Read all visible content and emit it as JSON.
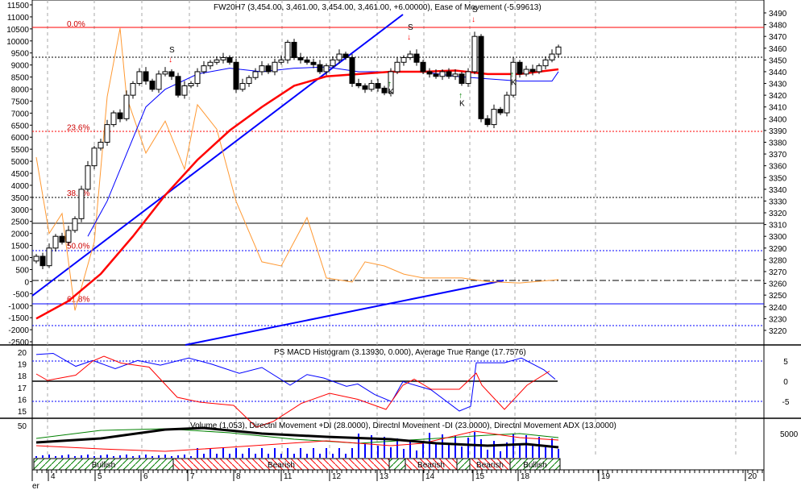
{
  "chart_data": [
    {
      "type": "candlestick",
      "title": "FW20H7 (3,454.00, 3,461.00, 3,454.00, 3,461.00, +6.00000), Ease of Movement (-5.99613)",
      "left_axis": {
        "range": [
          -2500,
          11500
        ],
        "ticks": [
          "11500",
          "11000",
          "10500",
          "10000",
          "9500",
          "9000",
          "8500",
          "8000",
          "7500",
          "7000",
          "6500",
          "6000",
          "5500",
          "5000",
          "4500",
          "4000",
          "3500",
          "3000",
          "2500",
          "2000",
          "1500",
          "1000",
          "500",
          "0",
          "-500",
          "-1000",
          "-1500",
          "-2000",
          "-2500"
        ]
      },
      "right_axis": {
        "range": [
          3220,
          3490
        ],
        "ticks": [
          "3490",
          "3480",
          "3470",
          "3460",
          "3450",
          "3440",
          "3430",
          "3420",
          "3410",
          "3400",
          "3390",
          "3380",
          "3370",
          "3360",
          "3350",
          "3340",
          "3330",
          "3320",
          "3310",
          "3300",
          "3290",
          "3280",
          "3270",
          "3260",
          "3250",
          "3240",
          "3230",
          "3220"
        ]
      },
      "fib_levels": [
        {
          "label": "0.0%",
          "price": 3477
        },
        {
          "label": "23.6%",
          "price": 3389
        },
        {
          "label": "38.2%",
          "price": 3333
        },
        {
          "label": "50.0%",
          "price": 3288
        },
        {
          "label": "61.8%",
          "price": 3243
        }
      ],
      "closes": [
        3283,
        3275,
        3290,
        3300,
        3295,
        3305,
        3315,
        3340,
        3360,
        3375,
        3380,
        3395,
        3405,
        3400,
        3420,
        3430,
        3440,
        3432,
        3425,
        3438,
        3440,
        3436,
        3420,
        3428,
        3430,
        3440,
        3445,
        3448,
        3450,
        3452,
        3448,
        3425,
        3430,
        3435,
        3440,
        3445,
        3440,
        3448,
        3450,
        3465,
        3452,
        3450,
        3448,
        3446,
        3440,
        3445,
        3450,
        3455,
        3452,
        3430,
        3428,
        3425,
        3430,
        3426,
        3422,
        3440,
        3448,
        3452,
        3455,
        3448,
        3440,
        3438,
        3436,
        3440,
        3436,
        3438,
        3430,
        3440,
        3470,
        3400,
        3395,
        3408,
        3405,
        3420,
        3448,
        3438,
        3442,
        3440,
        3445,
        3450,
        3455,
        3461
      ],
      "red_ma": [
        [
          0,
          3230
        ],
        [
          5,
          3245
        ],
        [
          10,
          3268
        ],
        [
          15,
          3300
        ],
        [
          20,
          3335
        ],
        [
          25,
          3365
        ],
        [
          30,
          3390
        ],
        [
          35,
          3410
        ],
        [
          40,
          3428
        ],
        [
          45,
          3436
        ],
        [
          50,
          3438
        ],
        [
          55,
          3440
        ],
        [
          60,
          3440
        ],
        [
          65,
          3441
        ],
        [
          70,
          3438
        ],
        [
          75,
          3438
        ],
        [
          81,
          3442
        ]
      ],
      "blue_ma": [
        [
          8,
          3300
        ],
        [
          11,
          3330
        ],
        [
          14,
          3370
        ],
        [
          17,
          3410
        ],
        [
          20,
          3425
        ],
        [
          25,
          3438
        ],
        [
          30,
          3443
        ],
        [
          35,
          3440
        ],
        [
          40,
          3443
        ],
        [
          45,
          3444
        ],
        [
          50,
          3440
        ],
        [
          55,
          3440
        ],
        [
          60,
          3440
        ],
        [
          65,
          3436
        ],
        [
          70,
          3434
        ],
        [
          75,
          3432
        ],
        [
          80,
          3432
        ],
        [
          81,
          3440
        ]
      ],
      "eom": [
        [
          0,
          5170
        ],
        [
          2,
          2000
        ],
        [
          4,
          2830
        ],
        [
          6,
          -1200
        ],
        [
          9,
          1650
        ],
        [
          11,
          7680
        ],
        [
          13,
          10530
        ],
        [
          14,
          7680
        ],
        [
          17,
          5340
        ],
        [
          20,
          6670
        ],
        [
          23,
          4670
        ],
        [
          25,
          7350
        ],
        [
          28,
          6330
        ],
        [
          31,
          3330
        ],
        [
          35,
          820
        ],
        [
          38,
          650
        ],
        [
          42,
          2660
        ],
        [
          45,
          150
        ],
        [
          49,
          -20
        ],
        [
          51,
          820
        ],
        [
          54,
          650
        ],
        [
          57,
          310
        ],
        [
          60,
          150
        ],
        [
          66,
          150
        ],
        [
          70,
          0
        ],
        [
          75,
          -60
        ],
        [
          81,
          80
        ]
      ],
      "signals": [
        {
          "label": "S",
          "bar": 21
        },
        {
          "label": "S",
          "bar": 58
        },
        {
          "label": "S",
          "bar": 68
        },
        {
          "label": "K",
          "bar": 55
        },
        {
          "label": "K",
          "bar": 66
        },
        {
          "label": "K",
          "bar": 74
        }
      ]
    },
    {
      "type": "line",
      "title": "PS MACD Histogram (3.13930, 0.000), Average True Range (17.7576)",
      "left_ticks": [
        "20",
        "19",
        "18",
        "17",
        "16",
        "15"
      ],
      "right_ticks": [
        "5",
        "0",
        "-5"
      ],
      "series": [
        {
          "name": "Average True Range",
          "color": "#0000ff",
          "points": [
            [
              0,
              19.8
            ],
            [
              3,
              19.9
            ],
            [
              7,
              18.8
            ],
            [
              10,
              19.3
            ],
            [
              14,
              18.6
            ],
            [
              18,
              19.3
            ],
            [
              22,
              18.9
            ],
            [
              27,
              19.5
            ],
            [
              31,
              19.0
            ],
            [
              36,
              18.2
            ],
            [
              40,
              18.7
            ],
            [
              45,
              17.2
            ],
            [
              48,
              18.1
            ],
            [
              51,
              17.8
            ],
            [
              55,
              17.1
            ],
            [
              57,
              17.3
            ],
            [
              60,
              16.4
            ],
            [
              63,
              15.8
            ],
            [
              65,
              17.5
            ],
            [
              70,
              16.8
            ],
            [
              75,
              15.0
            ],
            [
              77,
              15.4
            ],
            [
              78,
              19.1
            ],
            [
              83,
              19.1
            ],
            [
              86,
              19.5
            ],
            [
              90,
              18.5
            ],
            [
              92,
              17.7
            ]
          ]
        },
        {
          "name": "PS MACD Histogram",
          "color": "#ff0000",
          "points": [
            [
              0,
              1.8
            ],
            [
              2,
              0.2
            ],
            [
              7,
              1.5
            ],
            [
              10,
              5
            ],
            [
              12,
              6.2
            ],
            [
              15,
              4.5
            ],
            [
              20,
              3.5
            ],
            [
              25,
              -4
            ],
            [
              29,
              -5.2
            ],
            [
              35,
              -6
            ],
            [
              39,
              -11.4
            ],
            [
              42,
              -10
            ],
            [
              47,
              -5.5
            ],
            [
              52,
              -3
            ],
            [
              57,
              -4.5
            ],
            [
              62,
              -7
            ],
            [
              65,
              -1
            ],
            [
              67,
              0.5
            ],
            [
              70,
              -2
            ],
            [
              75,
              -2
            ],
            [
              78,
              2
            ],
            [
              79,
              -1
            ],
            [
              83,
              -7
            ],
            [
              87,
              -1
            ],
            [
              91,
              2.5
            ]
          ]
        }
      ],
      "right_range": [
        -8,
        8
      ]
    },
    {
      "type": "bar",
      "title": "Volume (1,053), Directnl Movement +DI (28.0000), Directnl Movement -DI (23.0000), Directnl Movement ADX (13.0000)",
      "left_ticks": [
        "50"
      ],
      "right_ticks": [
        "5000"
      ]
    },
    {
      "type": "table",
      "bands": [
        {
          "label": "Bullish",
          "kind": "bull"
        },
        {
          "label": "Bearish",
          "kind": "bear"
        },
        {
          "label": "",
          "kind": "bull"
        },
        {
          "label": "Bearish",
          "kind": "bear"
        },
        {
          "label": "",
          "kind": "bull"
        },
        {
          "label": "Bearish",
          "kind": "bear"
        },
        {
          "label": "Bullish",
          "kind": "bull"
        }
      ],
      "dates": [
        "4",
        "5",
        "6",
        "7",
        "8",
        "11",
        "12",
        "13",
        "14",
        "15",
        "18",
        "19",
        "20"
      ],
      "corner_label": "er"
    }
  ]
}
